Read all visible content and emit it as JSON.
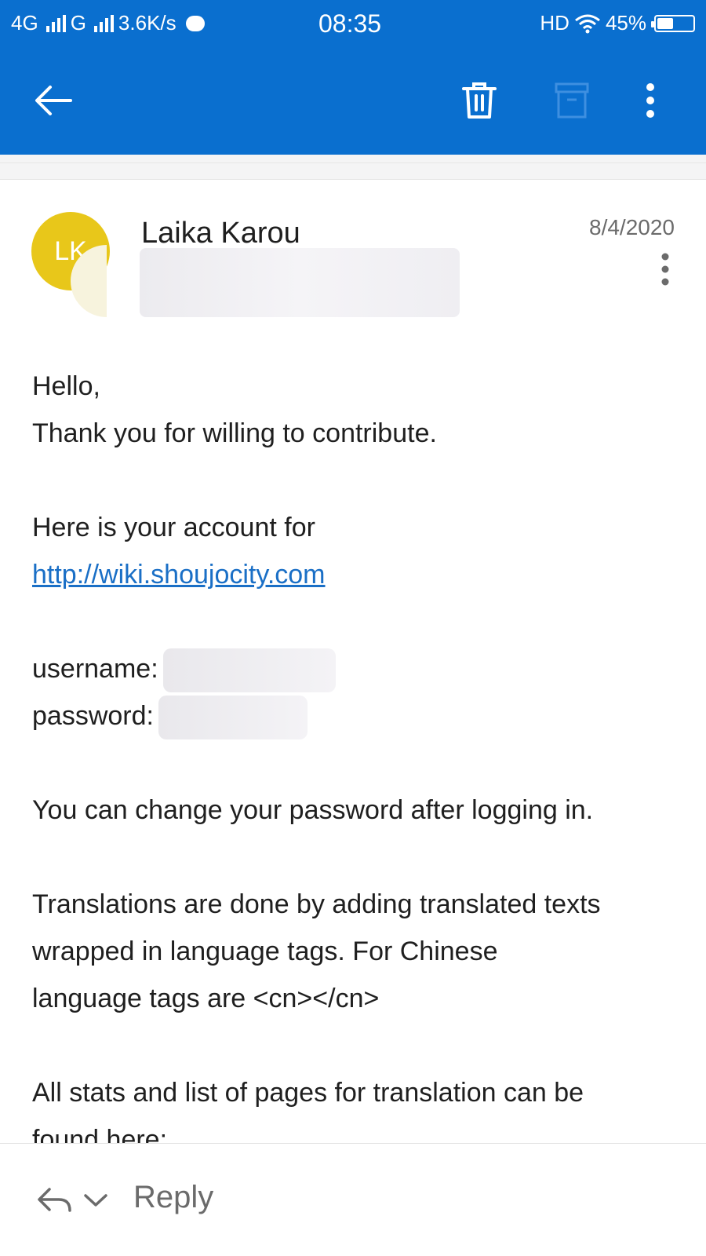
{
  "status_bar": {
    "network_1": "4G",
    "network_2": "G",
    "speed": "3.6K/s",
    "time": "08:35",
    "hd": "HD",
    "battery_text": "45%",
    "battery_level": 0.45
  },
  "toolbar": {
    "back_icon": "arrow-left-icon",
    "delete_icon": "trash-icon",
    "archive_icon": "archive-icon",
    "more_icon": "more-vertical-icon"
  },
  "email": {
    "avatar_initials": "LK",
    "avatar_color": "#e8c71a",
    "sender_name": "Laika Karou",
    "date": "8/4/2020",
    "body": {
      "greeting": "Hello,",
      "thanks": "Thank you for willing to contribute.",
      "account_intro": "Here is your account for",
      "link": "http://wiki.shoujocity.com",
      "username_label": "username:",
      "password_label": "password:",
      "change_password": "You can change your password after logging in.",
      "translations_1": "Translations are done by adding translated texts",
      "translations_2": "wrapped in language tags. For Chinese",
      "translations_3": "language tags are <cn></cn>",
      "stats_1": "All stats and list of pages for translation can be",
      "stats_2": "found here:"
    }
  },
  "footer": {
    "reply_label": "Reply"
  },
  "colors": {
    "appbar": "#0a6fcf",
    "link": "#1a6fc6"
  }
}
